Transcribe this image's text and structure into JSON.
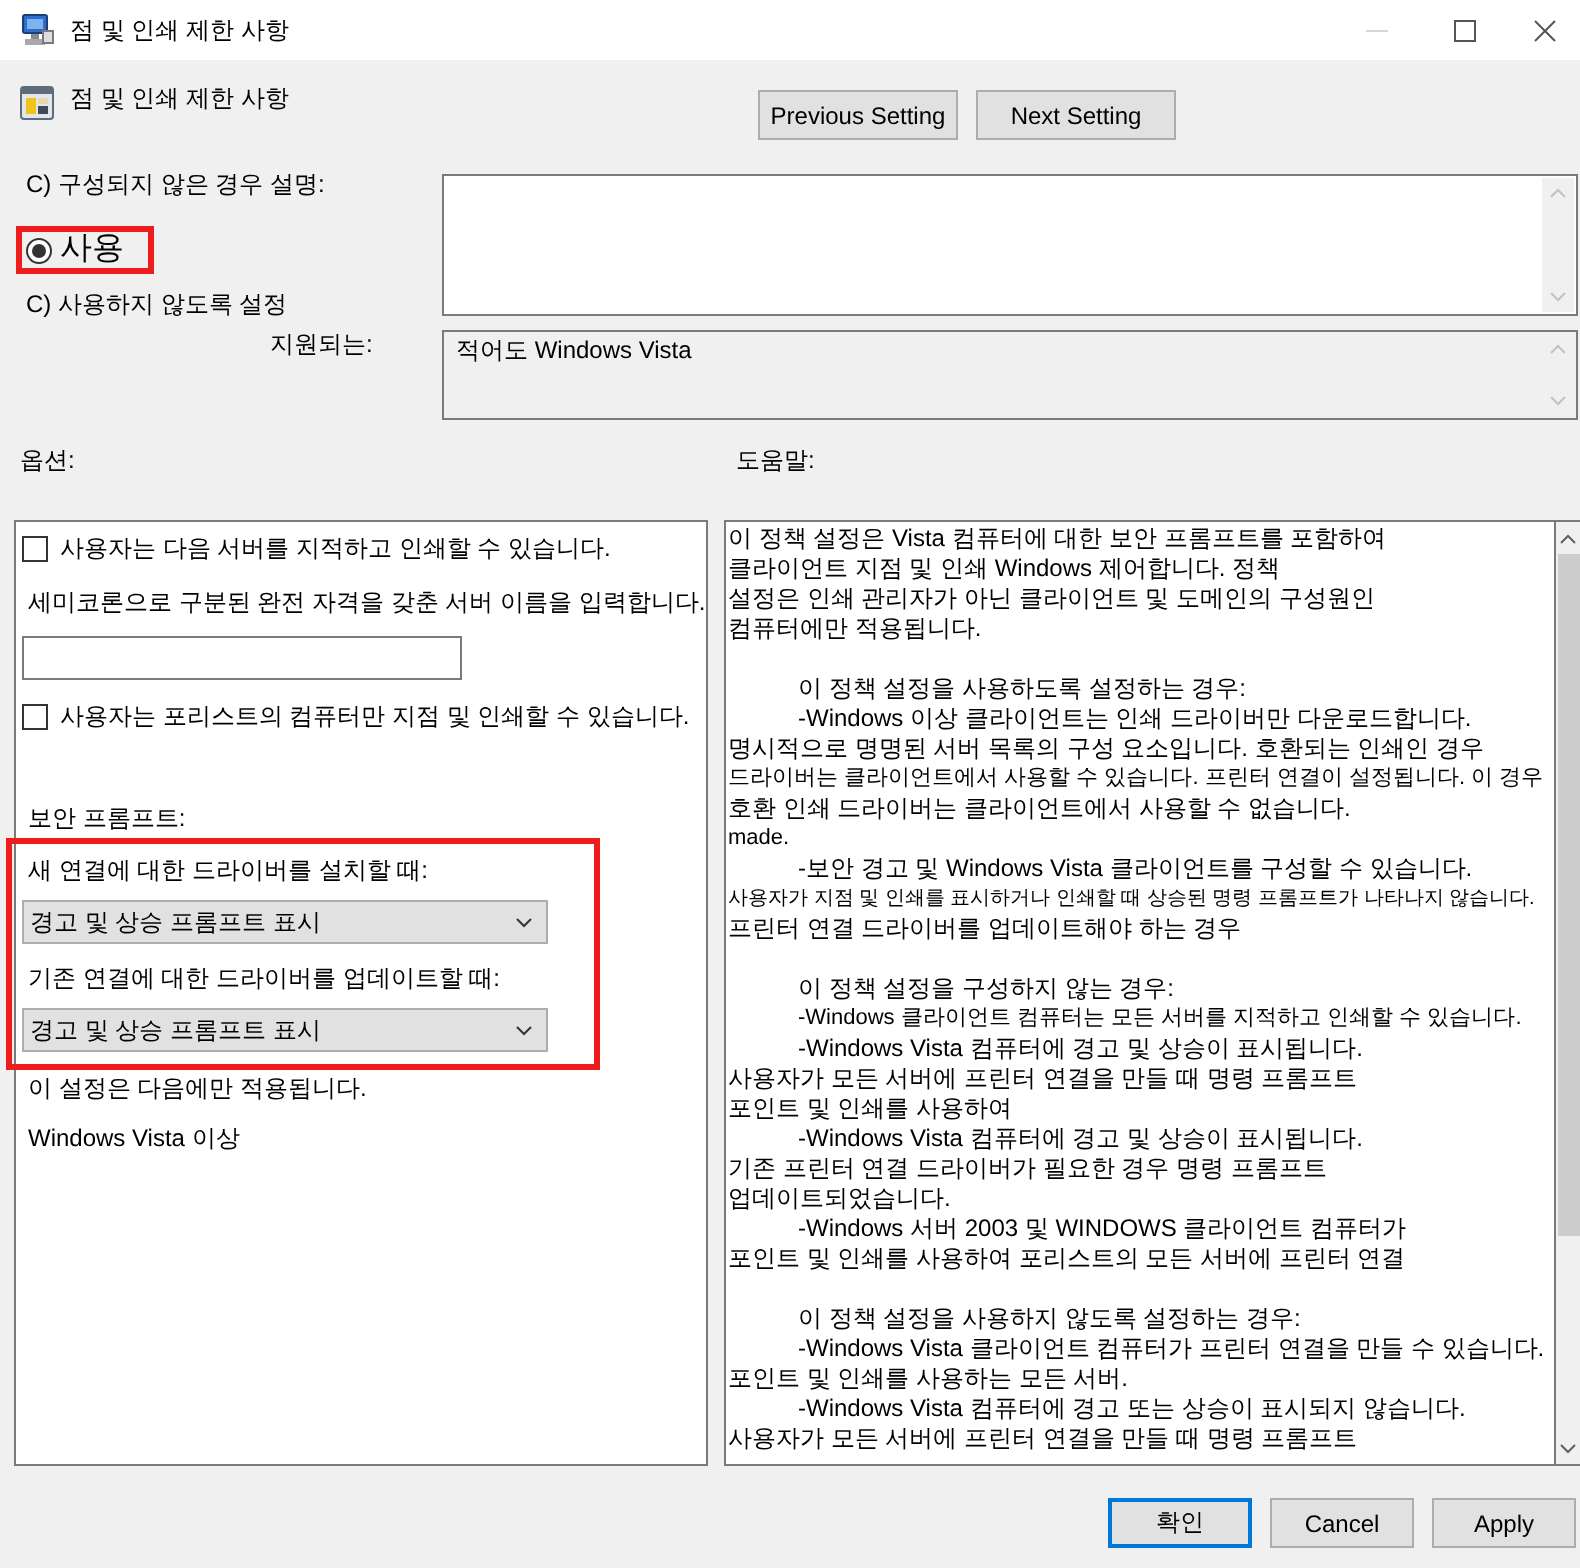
{
  "window": {
    "title": "점 및 인쇄 제한 사항"
  },
  "header": {
    "policy_name": "점 및 인쇄 제한 사항",
    "buttons": [
      {
        "label": "Previous Setting"
      },
      {
        "label": "Next Setting"
      }
    ]
  },
  "state_options": [
    {
      "label": "C) 구성되지 않은 경우",
      "selected": false,
      "highlighted": false
    },
    {
      "label": "사용",
      "selected": true,
      "highlighted": true
    },
    {
      "label": "C) 사용하지 않도록 설정",
      "selected": false,
      "highlighted": false
    }
  ],
  "comment": {
    "label": "설명:"
  },
  "supported_on": {
    "label": "지원되는:",
    "value": "적어도 Windows Vista"
  },
  "options": {
    "label": "옵션:",
    "items": [
      {
        "kind": "checkbox",
        "label": "사용자는 다음 서버를 지적하고 인쇄할 수 있습니다.",
        "checked": false
      },
      {
        "kind": "text",
        "label": "세미코론으로 구분된 완전 자격을 갖춘 서버 이름을 입력합니다."
      },
      {
        "kind": "input"
      },
      {
        "kind": "checkbox",
        "label": "사용자는 포리스트의 컴퓨터만 지점 및 인쇄할 수 있습니다.",
        "checked": false
      },
      {
        "kind": "heading",
        "label": "보안 프롬프트:"
      },
      {
        "kind": "group",
        "highlighted": true,
        "items": [
          {
            "kind": "text",
            "label": "새 연결에 대한 드라이버를 설치할 때:"
          },
          {
            "kind": "dropdown",
            "value": "경고 및 상승 프롬프트 표시"
          },
          {
            "kind": "text",
            "label": "기존 연결에 대한 드라이버를 업데이트할 때:"
          },
          {
            "kind": "dropdown",
            "value": "경고 및 상승 프롬프트 표시"
          }
        ]
      },
      {
        "kind": "text",
        "label": "이 설정은 다음에만 적용됩니다."
      },
      {
        "kind": "text",
        "label": "Windows Vista 이상"
      }
    ]
  },
  "help": {
    "label": "도움말:",
    "paragraphs": [
      {
        "lines": [
          {
            "text": "이 정책 설정은 Vista 컴퓨터에 대한 보안 프롬프트를 포함하여",
            "kind": "plain"
          },
          {
            "text": "클라이언트 지점 및 인쇄 Windows 제어합니다. 정책",
            "kind": "plain"
          },
          {
            "text": "설정은 인쇄 관리자가 아닌 클라이언트 및 도메인의 구성원인",
            "kind": "plain"
          },
          {
            "text": "컴퓨터에만 적용됩니다.",
            "kind": "plain"
          }
        ]
      },
      {
        "lines": [
          {
            "text": "이 정책 설정을 사용하도록 설정하는 경우:",
            "kind": "indented"
          },
          {
            "text": "-Windows 이상 클라이언트는 인쇄 드라이버만 다운로드합니다.",
            "kind": "indented"
          },
          {
            "text": "명시적으로 명명된 서버 목록의 구성 요소입니다. 호환되는 인쇄인 경우",
            "kind": "plain"
          },
          {
            "text": "드라이버는 클라이언트에서 사용할 수 있습니다. 프린터 연결이 설정됩니다. 이 경우",
            "kind": "small"
          },
          {
            "text": "호환 인쇄 드라이버는 클라이언트에서 사용할 수 없습니다.",
            "kind": "plain"
          },
          {
            "text": "made.",
            "kind": "small"
          },
          {
            "text": "-보안 경고 및 Windows Vista 클라이언트를 구성할 수 있습니다.",
            "kind": "indented"
          },
          {
            "text": "사용자가 지점 및 인쇄를 표시하거나 인쇄할 때 상승된 명령 프롬프트가 나타나지 않습니다.",
            "kind": "tiny"
          },
          {
            "text": "프린터 연결 드라이버를 업데이트해야 하는 경우",
            "kind": "plain"
          }
        ]
      },
      {
        "lines": [
          {
            "text": "이 정책 설정을 구성하지 않는 경우:",
            "kind": "indented"
          },
          {
            "text": "-Windows 클라이언트 컴퓨터는 모든 서버를 지적하고 인쇄할 수 있습니다.",
            "kind": "indented_small"
          },
          {
            "text": "-Windows Vista 컴퓨터에 경고 및 상승이 표시됩니다.",
            "kind": "indented"
          },
          {
            "text": "사용자가 모든 서버에 프린터 연결을 만들 때 명령 프롬프트",
            "kind": "plain"
          },
          {
            "text": "포인트 및 인쇄를 사용하여",
            "kind": "plain"
          },
          {
            "text": "-Windows Vista 컴퓨터에 경고 및 상승이 표시됩니다.",
            "kind": "indented"
          },
          {
            "text": "기존 프린터 연결 드라이버가 필요한 경우 명령 프롬프트",
            "kind": "plain"
          },
          {
            "text": "업데이트되었습니다.",
            "kind": "plain"
          },
          {
            "text": "-Windows 서버 2003 및 WINDOWS 클라이언트 컴퓨터가",
            "kind": "indented"
          },
          {
            "text": "포인트 및 인쇄를 사용하여 포리스트의 모든 서버에 프린터 연결",
            "kind": "plain"
          }
        ]
      },
      {
        "lines": [
          {
            "text": "이 정책 설정을 사용하지 않도록 설정하는 경우:",
            "kind": "indented"
          },
          {
            "text": "-Windows Vista 클라이언트 컴퓨터가 프린터 연결을 만들 수 있습니다.",
            "kind": "indented"
          },
          {
            "text": "포인트 및 인쇄를 사용하는 모든 서버.",
            "kind": "plain"
          },
          {
            "text": "-Windows Vista 컴퓨터에 경고 또는 상승이 표시되지 않습니다.",
            "kind": "indented"
          },
          {
            "text": "사용자가 모든 서버에 프린터 연결을 만들 때 명령 프롬프트",
            "kind": "plain"
          }
        ]
      }
    ]
  },
  "footer_buttons": [
    {
      "label": "확인",
      "default": true
    },
    {
      "label": "Cancel",
      "default": false
    },
    {
      "label": "Apply",
      "default": false
    }
  ]
}
